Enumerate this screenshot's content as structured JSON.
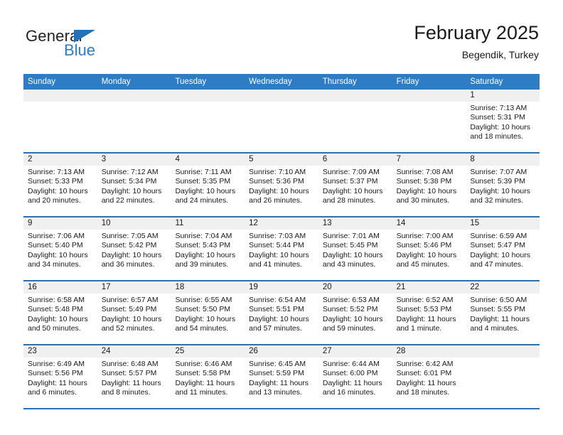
{
  "brand": {
    "name_top": "General",
    "name_bottom": "Blue",
    "triangle_color": "#2372b9",
    "blue_color": "#2e7cc4"
  },
  "header": {
    "title": "February 2025",
    "subtitle": "Begendik, Turkey"
  },
  "theme": {
    "header_blue": "#2e7cc4",
    "row_divider_blue": "#2e6fb0",
    "date_band_gray": "#f0f0f0",
    "text_color": "#1a1a1a"
  },
  "weekdays": [
    "Sunday",
    "Monday",
    "Tuesday",
    "Wednesday",
    "Thursday",
    "Friday",
    "Saturday"
  ],
  "weeks": [
    {
      "days": [
        {
          "number": "",
          "sunrise": "",
          "sunset": "",
          "daylight_line1": "",
          "daylight_line2": "",
          "empty": true
        },
        {
          "number": "",
          "sunrise": "",
          "sunset": "",
          "daylight_line1": "",
          "daylight_line2": "",
          "empty": true
        },
        {
          "number": "",
          "sunrise": "",
          "sunset": "",
          "daylight_line1": "",
          "daylight_line2": "",
          "empty": true
        },
        {
          "number": "",
          "sunrise": "",
          "sunset": "",
          "daylight_line1": "",
          "daylight_line2": "",
          "empty": true
        },
        {
          "number": "",
          "sunrise": "",
          "sunset": "",
          "daylight_line1": "",
          "daylight_line2": "",
          "empty": true
        },
        {
          "number": "",
          "sunrise": "",
          "sunset": "",
          "daylight_line1": "",
          "daylight_line2": "",
          "empty": true
        },
        {
          "number": "1",
          "sunrise": "Sunrise: 7:13 AM",
          "sunset": "Sunset: 5:31 PM",
          "daylight_line1": "Daylight: 10 hours",
          "daylight_line2": "and 18 minutes.",
          "empty": false
        }
      ]
    },
    {
      "days": [
        {
          "number": "2",
          "sunrise": "Sunrise: 7:13 AM",
          "sunset": "Sunset: 5:33 PM",
          "daylight_line1": "Daylight: 10 hours",
          "daylight_line2": "and 20 minutes.",
          "empty": false
        },
        {
          "number": "3",
          "sunrise": "Sunrise: 7:12 AM",
          "sunset": "Sunset: 5:34 PM",
          "daylight_line1": "Daylight: 10 hours",
          "daylight_line2": "and 22 minutes.",
          "empty": false
        },
        {
          "number": "4",
          "sunrise": "Sunrise: 7:11 AM",
          "sunset": "Sunset: 5:35 PM",
          "daylight_line1": "Daylight: 10 hours",
          "daylight_line2": "and 24 minutes.",
          "empty": false
        },
        {
          "number": "5",
          "sunrise": "Sunrise: 7:10 AM",
          "sunset": "Sunset: 5:36 PM",
          "daylight_line1": "Daylight: 10 hours",
          "daylight_line2": "and 26 minutes.",
          "empty": false
        },
        {
          "number": "6",
          "sunrise": "Sunrise: 7:09 AM",
          "sunset": "Sunset: 5:37 PM",
          "daylight_line1": "Daylight: 10 hours",
          "daylight_line2": "and 28 minutes.",
          "empty": false
        },
        {
          "number": "7",
          "sunrise": "Sunrise: 7:08 AM",
          "sunset": "Sunset: 5:38 PM",
          "daylight_line1": "Daylight: 10 hours",
          "daylight_line2": "and 30 minutes.",
          "empty": false
        },
        {
          "number": "8",
          "sunrise": "Sunrise: 7:07 AM",
          "sunset": "Sunset: 5:39 PM",
          "daylight_line1": "Daylight: 10 hours",
          "daylight_line2": "and 32 minutes.",
          "empty": false
        }
      ]
    },
    {
      "days": [
        {
          "number": "9",
          "sunrise": "Sunrise: 7:06 AM",
          "sunset": "Sunset: 5:40 PM",
          "daylight_line1": "Daylight: 10 hours",
          "daylight_line2": "and 34 minutes.",
          "empty": false
        },
        {
          "number": "10",
          "sunrise": "Sunrise: 7:05 AM",
          "sunset": "Sunset: 5:42 PM",
          "daylight_line1": "Daylight: 10 hours",
          "daylight_line2": "and 36 minutes.",
          "empty": false
        },
        {
          "number": "11",
          "sunrise": "Sunrise: 7:04 AM",
          "sunset": "Sunset: 5:43 PM",
          "daylight_line1": "Daylight: 10 hours",
          "daylight_line2": "and 39 minutes.",
          "empty": false
        },
        {
          "number": "12",
          "sunrise": "Sunrise: 7:03 AM",
          "sunset": "Sunset: 5:44 PM",
          "daylight_line1": "Daylight: 10 hours",
          "daylight_line2": "and 41 minutes.",
          "empty": false
        },
        {
          "number": "13",
          "sunrise": "Sunrise: 7:01 AM",
          "sunset": "Sunset: 5:45 PM",
          "daylight_line1": "Daylight: 10 hours",
          "daylight_line2": "and 43 minutes.",
          "empty": false
        },
        {
          "number": "14",
          "sunrise": "Sunrise: 7:00 AM",
          "sunset": "Sunset: 5:46 PM",
          "daylight_line1": "Daylight: 10 hours",
          "daylight_line2": "and 45 minutes.",
          "empty": false
        },
        {
          "number": "15",
          "sunrise": "Sunrise: 6:59 AM",
          "sunset": "Sunset: 5:47 PM",
          "daylight_line1": "Daylight: 10 hours",
          "daylight_line2": "and 47 minutes.",
          "empty": false
        }
      ]
    },
    {
      "days": [
        {
          "number": "16",
          "sunrise": "Sunrise: 6:58 AM",
          "sunset": "Sunset: 5:48 PM",
          "daylight_line1": "Daylight: 10 hours",
          "daylight_line2": "and 50 minutes.",
          "empty": false
        },
        {
          "number": "17",
          "sunrise": "Sunrise: 6:57 AM",
          "sunset": "Sunset: 5:49 PM",
          "daylight_line1": "Daylight: 10 hours",
          "daylight_line2": "and 52 minutes.",
          "empty": false
        },
        {
          "number": "18",
          "sunrise": "Sunrise: 6:55 AM",
          "sunset": "Sunset: 5:50 PM",
          "daylight_line1": "Daylight: 10 hours",
          "daylight_line2": "and 54 minutes.",
          "empty": false
        },
        {
          "number": "19",
          "sunrise": "Sunrise: 6:54 AM",
          "sunset": "Sunset: 5:51 PM",
          "daylight_line1": "Daylight: 10 hours",
          "daylight_line2": "and 57 minutes.",
          "empty": false
        },
        {
          "number": "20",
          "sunrise": "Sunrise: 6:53 AM",
          "sunset": "Sunset: 5:52 PM",
          "daylight_line1": "Daylight: 10 hours",
          "daylight_line2": "and 59 minutes.",
          "empty": false
        },
        {
          "number": "21",
          "sunrise": "Sunrise: 6:52 AM",
          "sunset": "Sunset: 5:53 PM",
          "daylight_line1": "Daylight: 11 hours",
          "daylight_line2": "and 1 minute.",
          "empty": false
        },
        {
          "number": "22",
          "sunrise": "Sunrise: 6:50 AM",
          "sunset": "Sunset: 5:55 PM",
          "daylight_line1": "Daylight: 11 hours",
          "daylight_line2": "and 4 minutes.",
          "empty": false
        }
      ]
    },
    {
      "days": [
        {
          "number": "23",
          "sunrise": "Sunrise: 6:49 AM",
          "sunset": "Sunset: 5:56 PM",
          "daylight_line1": "Daylight: 11 hours",
          "daylight_line2": "and 6 minutes.",
          "empty": false
        },
        {
          "number": "24",
          "sunrise": "Sunrise: 6:48 AM",
          "sunset": "Sunset: 5:57 PM",
          "daylight_line1": "Daylight: 11 hours",
          "daylight_line2": "and 8 minutes.",
          "empty": false
        },
        {
          "number": "25",
          "sunrise": "Sunrise: 6:46 AM",
          "sunset": "Sunset: 5:58 PM",
          "daylight_line1": "Daylight: 11 hours",
          "daylight_line2": "and 11 minutes.",
          "empty": false
        },
        {
          "number": "26",
          "sunrise": "Sunrise: 6:45 AM",
          "sunset": "Sunset: 5:59 PM",
          "daylight_line1": "Daylight: 11 hours",
          "daylight_line2": "and 13 minutes.",
          "empty": false
        },
        {
          "number": "27",
          "sunrise": "Sunrise: 6:44 AM",
          "sunset": "Sunset: 6:00 PM",
          "daylight_line1": "Daylight: 11 hours",
          "daylight_line2": "and 16 minutes.",
          "empty": false
        },
        {
          "number": "28",
          "sunrise": "Sunrise: 6:42 AM",
          "sunset": "Sunset: 6:01 PM",
          "daylight_line1": "Daylight: 11 hours",
          "daylight_line2": "and 18 minutes.",
          "empty": false
        },
        {
          "number": "",
          "sunrise": "",
          "sunset": "",
          "daylight_line1": "",
          "daylight_line2": "",
          "empty": true
        }
      ]
    }
  ]
}
